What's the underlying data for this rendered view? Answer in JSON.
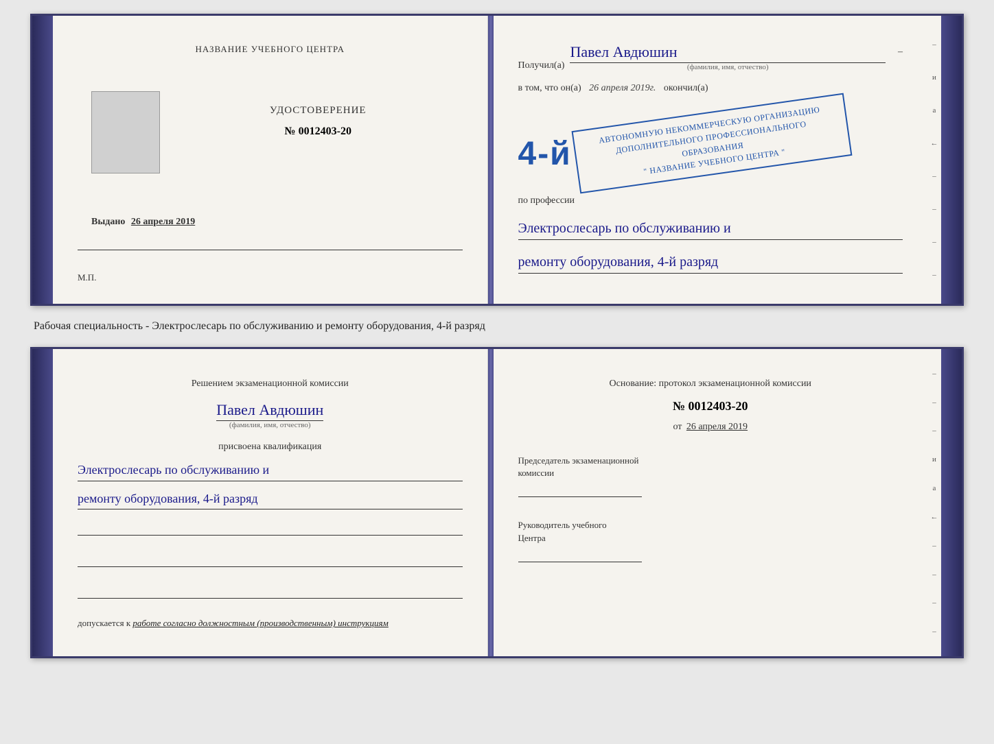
{
  "top_document": {
    "left": {
      "school_name": "НАЗВАНИЕ УЧЕБНОГО ЦЕНТРА",
      "certificate_title": "УДОСТОВЕРЕНИЕ",
      "certificate_number": "№ 0012403-20",
      "issued_label": "Выдано",
      "issued_date": "26 апреля 2019",
      "mp_label": "М.П."
    },
    "right": {
      "received_label": "Получил(а)",
      "recipient_name": "Павел Авдюшин",
      "fio_subtitle": "(фамилия, имя, отчество)",
      "in_that_label": "в том, что он(а)",
      "completion_date": "26 апреля 2019г.",
      "finished_label": "окончил(а)",
      "big_grade": "4-й",
      "org_line1": "АВТОНОМНУЮ НЕКОММЕРЧЕСКУЮ ОРГАНИЗАЦИЮ",
      "org_line2": "ДОПОЛНИТЕЛЬНОГО ПРОФЕССИОНАЛЬНОГО ОБРАЗОВАНИЯ",
      "org_line3": "\" НАЗВАНИЕ УЧЕБНОГО ЦЕНТРА \"",
      "profession_label": "по профессии",
      "profession_text": "Электрослесарь по обслуживанию и",
      "profession_text2": "ремонту оборудования, 4-й разряд"
    }
  },
  "middle_text": "Рабочая специальность - Электрослесарь по обслуживанию и ремонту оборудования, 4-й разряд",
  "bottom_document": {
    "left": {
      "commission_title_line1": "Решением экзаменационной комиссии",
      "person_name": "Павел Авдюшин",
      "fio_label": "(фамилия, имя, отчество)",
      "assigned_label": "присвоена квалификация",
      "qualification_line1": "Электрослесарь по обслуживанию и",
      "qualification_line2": "ремонту оборудования, 4-й разряд",
      "допускается_label": "допускается к",
      "допускается_text": "работе согласно должностным (производственным) инструкциям"
    },
    "right": {
      "osnov_label": "Основание: протокол экзаменационной комиссии",
      "protocol_number": "№ 0012403-20",
      "from_label": "от",
      "from_date": "26 апреля 2019",
      "chairman_title_line1": "Председатель экзаменационной",
      "chairman_title_line2": "комиссии",
      "head_title_line1": "Руководитель учебного",
      "head_title_line2": "Центра"
    }
  },
  "right_marks": [
    "-",
    "и",
    "а",
    "←",
    "-",
    "-",
    "-",
    "-"
  ]
}
